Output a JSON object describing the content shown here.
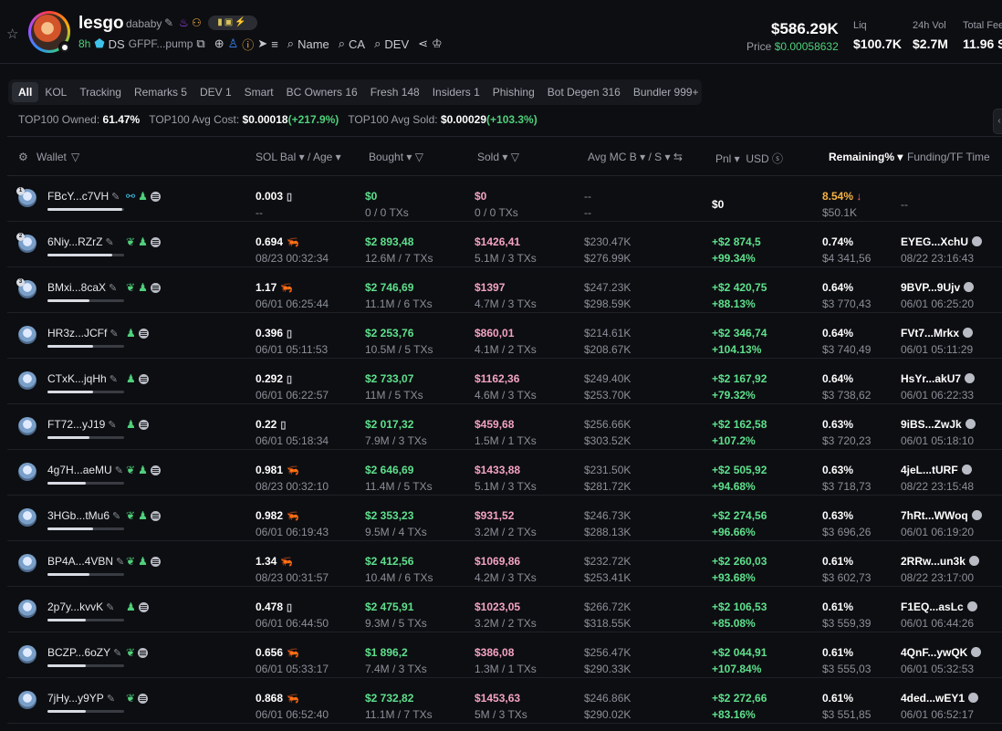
{
  "token": {
    "name": "lesgo",
    "ticker": "dababy",
    "age": "8h",
    "source": "DS",
    "contract": "GFPF...pump",
    "searches": [
      "Name",
      "CA",
      "DEV"
    ],
    "mcap": "$586.29K",
    "price_label": "Price",
    "price": "$0.00058632",
    "stats": [
      {
        "label": "Liq",
        "value": "$100.7K"
      },
      {
        "label": "24h Vol",
        "value": "$2.7M"
      },
      {
        "label": "Total Fees",
        "value": "11.96 S"
      }
    ]
  },
  "tabs": [
    "All",
    "KOL",
    "Tracking",
    "Remarks 5",
    "DEV 1",
    "Smart",
    "BC Owners 16",
    "Fresh 148",
    "Insiders 1",
    "Phishing",
    "Bot Degen 316",
    "Bundler 999+"
  ],
  "summary": {
    "owned_label": "TOP100 Owned:",
    "owned": "61.47%",
    "avg_cost_label": "TOP100 Avg Cost:",
    "avg_cost": "$0.00018",
    "avg_cost_change": "(+217.9%)",
    "avg_sold_label": "TOP100 Avg Sold:",
    "avg_sold": "$0.00029",
    "avg_sold_change": "(+103.3%)"
  },
  "columns": {
    "wallet": "Wallet",
    "sol_bal": "SOL Bal",
    "age": "/ Age",
    "bought": "Bought",
    "sold": "Sold",
    "avg_mc": "Avg MC B",
    "avg_mc_s": "/ S",
    "pnl": "Pnl",
    "usd": "USD",
    "remaining": "Remaining%",
    "funding": "Funding/TF Time"
  },
  "rows": [
    {
      "wallet": "FBcY...c7VH",
      "rank": "1",
      "bar": 0.98,
      "sol": "0.003",
      "age": "--",
      "bought": "$0",
      "bought_sub": "0 / 0 TXs",
      "sold": "$0",
      "sold_sub": "0 / 0 TXs",
      "mc_b": "--",
      "mc_s": "--",
      "pnl": "$0",
      "pnl_pct": "",
      "rem": "8.54%",
      "rem_usd": "$50.1K",
      "fund": "--",
      "fund_time": "",
      "rem_down": true,
      "shrimp": false
    },
    {
      "wallet": "6Niy...RZrZ",
      "rank": "2",
      "bar": 0.85,
      "sol": "0.694",
      "age": "08/23 00:32:34",
      "bought": "$2 893,48",
      "bought_sub": "12.6M / 7 TXs",
      "sold": "$1426,41",
      "sold_sub": "5.1M / 3 TXs",
      "mc_b": "$230.47K",
      "mc_s": "$276.99K",
      "pnl": "+$2 874,5",
      "pnl_pct": "+99.34%",
      "rem": "0.74%",
      "rem_usd": "$4 341,56",
      "fund": "EYEG...XchU",
      "fund_time": "08/22 23:16:43",
      "rem_down": false,
      "shrimp": true
    },
    {
      "wallet": "BMxi...8caX",
      "rank": "3",
      "bar": 0.55,
      "sol": "1.17",
      "age": "06/01 06:25:44",
      "bought": "$2 746,69",
      "bought_sub": "11.1M / 6 TXs",
      "sold": "$1397",
      "sold_sub": "4.7M / 3 TXs",
      "mc_b": "$247.23K",
      "mc_s": "$298.59K",
      "pnl": "+$2 420,75",
      "pnl_pct": "+88.13%",
      "rem": "0.64%",
      "rem_usd": "$3 770,43",
      "fund": "9BVP...9Ujv",
      "fund_time": "06/01 06:25:20",
      "rem_down": false,
      "shrimp": true
    },
    {
      "wallet": "HR3z...JCFf",
      "rank": "",
      "bar": 0.6,
      "sol": "0.396",
      "age": "06/01 05:11:53",
      "bought": "$2 253,76",
      "bought_sub": "10.5M / 5 TXs",
      "sold": "$860,01",
      "sold_sub": "4.1M / 2 TXs",
      "mc_b": "$214.61K",
      "mc_s": "$208.67K",
      "pnl": "+$2 346,74",
      "pnl_pct": "+104.13%",
      "rem": "0.64%",
      "rem_usd": "$3 740,49",
      "fund": "FVt7...Mrkx",
      "fund_time": "06/01 05:11:29",
      "rem_down": false,
      "shrimp": false
    },
    {
      "wallet": "CTxK...jqHh",
      "rank": "",
      "bar": 0.6,
      "sol": "0.292",
      "age": "06/01 06:22:57",
      "bought": "$2 733,07",
      "bought_sub": "11M / 5 TXs",
      "sold": "$1162,36",
      "sold_sub": "4.6M / 3 TXs",
      "mc_b": "$249.40K",
      "mc_s": "$253.70K",
      "pnl": "+$2 167,92",
      "pnl_pct": "+79.32%",
      "rem": "0.64%",
      "rem_usd": "$3 738,62",
      "fund": "HsYr...akU7",
      "fund_time": "06/01 06:22:33",
      "rem_down": false,
      "shrimp": false
    },
    {
      "wallet": "FT72...yJ19",
      "rank": "",
      "bar": 0.55,
      "sol": "0.22",
      "age": "06/01 05:18:34",
      "bought": "$2 017,32",
      "bought_sub": "7.9M / 3 TXs",
      "sold": "$459,68",
      "sold_sub": "1.5M / 1 TXs",
      "mc_b": "$256.66K",
      "mc_s": "$303.52K",
      "pnl": "+$2 162,58",
      "pnl_pct": "+107.2%",
      "rem": "0.63%",
      "rem_usd": "$3 720,23",
      "fund": "9iBS...ZwJk",
      "fund_time": "06/01 05:18:10",
      "rem_down": false,
      "shrimp": false
    },
    {
      "wallet": "4g7H...aeMU",
      "rank": "",
      "bar": 0.5,
      "sol": "0.981",
      "age": "08/23 00:32:10",
      "bought": "$2 646,69",
      "bought_sub": "11.4M / 5 TXs",
      "sold": "$1433,88",
      "sold_sub": "5.1M / 3 TXs",
      "mc_b": "$231.50K",
      "mc_s": "$281.72K",
      "pnl": "+$2 505,92",
      "pnl_pct": "+94.68%",
      "rem": "0.63%",
      "rem_usd": "$3 718,73",
      "fund": "4jeL...tURF",
      "fund_time": "08/22 23:15:48",
      "rem_down": false,
      "shrimp": true
    },
    {
      "wallet": "3HGb...tMu6",
      "rank": "",
      "bar": 0.6,
      "sol": "0.982",
      "age": "06/01 06:19:43",
      "bought": "$2 353,23",
      "bought_sub": "9.5M / 4 TXs",
      "sold": "$931,52",
      "sold_sub": "3.2M / 2 TXs",
      "mc_b": "$246.73K",
      "mc_s": "$288.13K",
      "pnl": "+$2 274,56",
      "pnl_pct": "+96.66%",
      "rem": "0.63%",
      "rem_usd": "$3 696,26",
      "fund": "7hRt...WWoq",
      "fund_time": "06/01 06:19:20",
      "rem_down": false,
      "shrimp": true
    },
    {
      "wallet": "BP4A...4VBN",
      "rank": "",
      "bar": 0.55,
      "sol": "1.34",
      "age": "08/23 00:31:57",
      "bought": "$2 412,56",
      "bought_sub": "10.4M / 6 TXs",
      "sold": "$1069,86",
      "sold_sub": "4.2M / 3 TXs",
      "mc_b": "$232.72K",
      "mc_s": "$253.41K",
      "pnl": "+$2 260,03",
      "pnl_pct": "+93.68%",
      "rem": "0.61%",
      "rem_usd": "$3 602,73",
      "fund": "2RRw...un3k",
      "fund_time": "08/22 23:17:00",
      "rem_down": false,
      "shrimp": true
    },
    {
      "wallet": "2p7y...kvvK",
      "rank": "",
      "bar": 0.5,
      "sol": "0.478",
      "age": "06/01 06:44:50",
      "bought": "$2 475,91",
      "bought_sub": "9.3M / 5 TXs",
      "sold": "$1023,05",
      "sold_sub": "3.2M / 2 TXs",
      "mc_b": "$266.72K",
      "mc_s": "$318.55K",
      "pnl": "+$2 106,53",
      "pnl_pct": "+85.08%",
      "rem": "0.61%",
      "rem_usd": "$3 559,39",
      "fund": "F1EQ...asLc",
      "fund_time": "06/01 06:44:26",
      "rem_down": false,
      "shrimp": false
    },
    {
      "wallet": "BCZP...6oZY",
      "rank": "",
      "bar": 0.5,
      "sol": "0.656",
      "age": "06/01 05:33:17",
      "bought": "$1 896,2",
      "bought_sub": "7.4M / 3 TXs",
      "sold": "$386,08",
      "sold_sub": "1.3M / 1 TXs",
      "mc_b": "$256.47K",
      "mc_s": "$290.33K",
      "pnl": "+$2 044,91",
      "pnl_pct": "+107.84%",
      "rem": "0.61%",
      "rem_usd": "$3 555,03",
      "fund": "4QnF...ywQK",
      "fund_time": "06/01 05:32:53",
      "rem_down": false,
      "shrimp": true
    },
    {
      "wallet": "7jHy...y9YP",
      "rank": "",
      "bar": 0.5,
      "sol": "0.868",
      "age": "06/01 06:52:40",
      "bought": "$2 732,82",
      "bought_sub": "11.1M / 7 TXs",
      "sold": "$1453,63",
      "sold_sub": "5M / 3 TXs",
      "mc_b": "$246.86K",
      "mc_s": "$290.02K",
      "pnl": "+$2 272,66",
      "pnl_pct": "+83.16%",
      "rem": "0.61%",
      "rem_usd": "$3 551,85",
      "fund": "4ded...wEY1",
      "fund_time": "06/01 06:52:17",
      "rem_down": false,
      "shrimp": true
    }
  ],
  "colors": {
    "green": "#5ee08c",
    "pink": "#f4a3c0",
    "orange": "#f5b342",
    "bg": "#0d0e12"
  }
}
